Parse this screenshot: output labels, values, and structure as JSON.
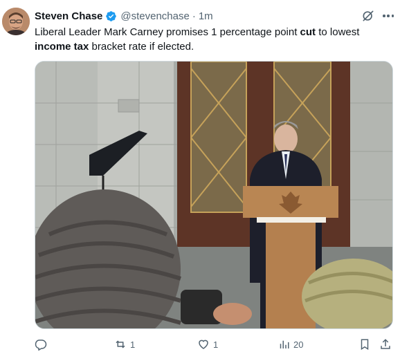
{
  "author": {
    "display_name": "Steven Chase",
    "handle": "@stevenchase",
    "separator": "·",
    "time": "1m",
    "verified_color": "#1d9bf0"
  },
  "tweet": {
    "text_part1": "Liberal Leader Mark Carney promises 1 percentage point ",
    "text_bold1": "cut",
    "text_part2": " to lowest ",
    "text_bold2": "income tax",
    "text_part3": " bracket rate if elected."
  },
  "actions": {
    "reply_icon": "reply-icon",
    "retweet_count": "1",
    "like_count": "1",
    "views_count": "20",
    "bookmark_icon": "bookmark-icon",
    "share_icon": "share-icon"
  },
  "colors": {
    "text": "#0f1419",
    "muted": "#536471",
    "border": "#cfd9de"
  }
}
